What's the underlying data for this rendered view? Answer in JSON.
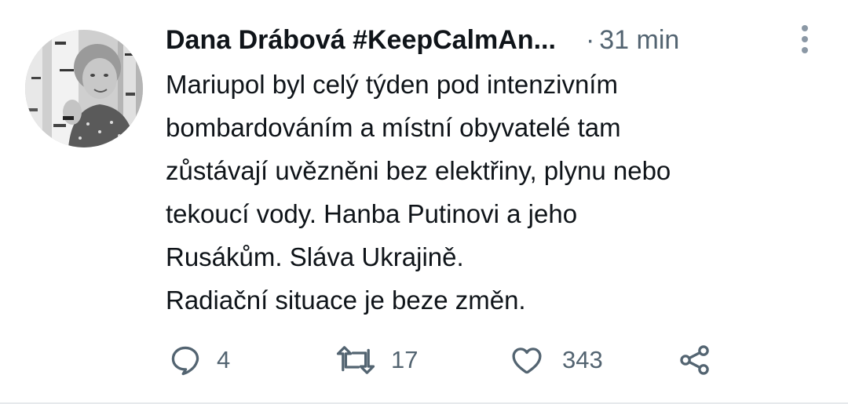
{
  "tweet": {
    "author": {
      "display_name": "Dana Drábová #KeepCalmAn...",
      "avatar": "profile-photo"
    },
    "separator": "·",
    "time": "31 min",
    "text": "Mariupol byl celý týden pod intenzivním\nbombardováním a místní obyvatelé tam\nzůstávají uvězněni bez elektřiny, plynu nebo\ntekoucí vody. Hanba Putinovi a jeho\nRusákům. Sláva Ukrajině.\nRadiační situace je beze změn.",
    "actions": {
      "reply": {
        "icon": "reply-icon",
        "count": "4"
      },
      "retweet": {
        "icon": "retweet-icon",
        "count": "17"
      },
      "like": {
        "icon": "heart-icon",
        "count": "343"
      },
      "share": {
        "icon": "share-icon"
      }
    }
  },
  "colors": {
    "text": "#0f1419",
    "muted": "#536471",
    "divider": "#e6e9ec"
  }
}
